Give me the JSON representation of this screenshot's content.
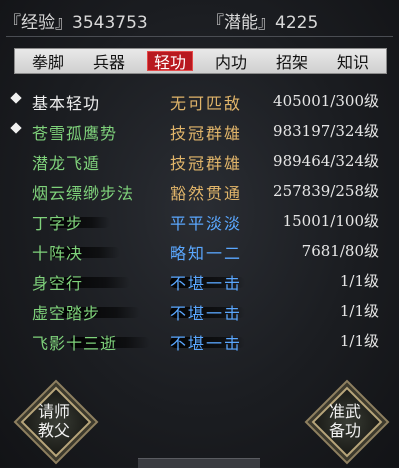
{
  "stats": {
    "exp_label": "『经验』",
    "exp_value": "3543753",
    "pot_label": "『潜能』",
    "pot_value": "4225"
  },
  "tabs": [
    {
      "label": "拳脚",
      "active": false
    },
    {
      "label": "兵器",
      "active": false
    },
    {
      "label": "轻功",
      "active": true
    },
    {
      "label": "内功",
      "active": false
    },
    {
      "label": "招架",
      "active": false
    },
    {
      "label": "知识",
      "active": false
    }
  ],
  "skills": [
    {
      "name": "基本轻功",
      "rank": "无可匹敌",
      "level": "405001/300级",
      "marked": true,
      "name_color": "#f0f0f0",
      "rank_color": "#e1b56a"
    },
    {
      "name": "苍雪孤鹰势",
      "rank": "技冠群雄",
      "level": "983197/324级",
      "marked": true,
      "name_color": "#7fd27b",
      "rank_color": "#e1b56a"
    },
    {
      "name": "潜龙飞遁",
      "rank": "技冠群雄",
      "level": "989464/324级",
      "marked": false,
      "name_color": "#7fd27b",
      "rank_color": "#e1b56a"
    },
    {
      "name": "烟云缥缈步法",
      "rank": "豁然贯通",
      "level": "257839/258级",
      "marked": false,
      "name_color": "#7fd27b",
      "rank_color": "#e1b56a"
    },
    {
      "name": "丁字步",
      "rank": "平平淡淡",
      "level": "15001/100级",
      "marked": false,
      "name_color": "#7fd27b",
      "rank_color": "#5aa7ff"
    },
    {
      "name": "十阵决",
      "rank": "略知一二",
      "level": "7681/80级",
      "marked": false,
      "name_color": "#7fd27b",
      "rank_color": "#5aa7ff"
    },
    {
      "name": "身空行",
      "rank": "不堪一击",
      "level": "1/1级",
      "marked": false,
      "name_color": "#7fd27b",
      "rank_color": "#5aa7ff"
    },
    {
      "name": "虚空踏步",
      "rank": "不堪一击",
      "level": "1/1级",
      "marked": false,
      "name_color": "#7fd27b",
      "rank_color": "#5aa7ff"
    },
    {
      "name": "飞影十三逝",
      "rank": "不堪一击",
      "level": "1/1级",
      "marked": false,
      "name_color": "#7fd27b",
      "rank_color": "#5aa7ff"
    }
  ],
  "buttons": {
    "left": {
      "line1": "请师",
      "line2": "教父"
    },
    "right": {
      "line1": "准武",
      "line2": "备功"
    }
  }
}
